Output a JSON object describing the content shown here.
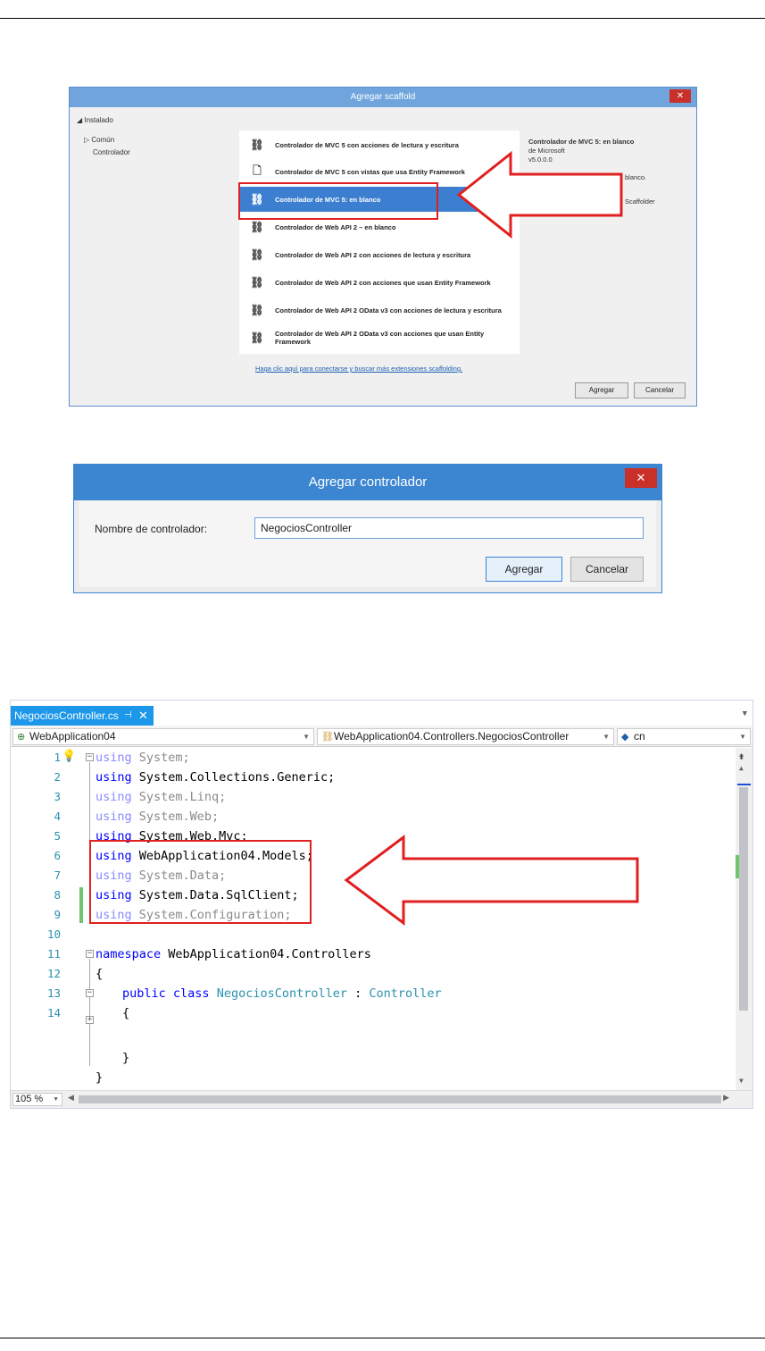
{
  "scaffold_dialog": {
    "title": "Agregar scaffold",
    "close": "✕",
    "tree": {
      "installed": "◢ Instalado",
      "common": "▷ Común",
      "controller": "Controlador"
    },
    "items": [
      {
        "label": "Controlador de MVC 5 con acciones de lectura y escritura",
        "icon": "controller-icon"
      },
      {
        "label": "Controlador de MVC 5 con vistas que usa Entity Framework",
        "icon": "page-icon"
      },
      {
        "label": "Controlador de MVC 5: en blanco",
        "icon": "controller-icon"
      },
      {
        "label": "Controlador de Web API 2 – en blanco",
        "icon": "controller-icon"
      },
      {
        "label": "Controlador de Web API 2 con acciones de lectura y escritura",
        "icon": "controller-icon"
      },
      {
        "label": "Controlador de Web API 2 con acciones que usan Entity Framework",
        "icon": "controller-icon"
      },
      {
        "label": "Controlador de Web API 2 OData v3 con acciones de lectura y escritura",
        "icon": "controller-icon"
      },
      {
        "label": "Controlador de Web API 2 OData v3 con acciones que usan Entity Framework",
        "icon": "controller-icon"
      }
    ],
    "selected_index": 2,
    "info": {
      "title": "Controlador de MVC 5: en blanco",
      "vendor": "de Microsoft",
      "version": "v5.0.0.0",
      "desc_tail": "blanco.",
      "scaffolder_tail": "Scaffolder"
    },
    "link": "Haga clic aquí para conectarse y buscar más extensiones scaffolding.",
    "add_button": "Agregar",
    "cancel_button": "Cancelar"
  },
  "controller_dialog": {
    "title": "Agregar controlador",
    "close": "✕",
    "label": "Nombre de controlador:",
    "name_value": "NegociosController",
    "add_button": "Agregar",
    "cancel_button": "Cancelar"
  },
  "editor": {
    "tab": {
      "title": "NegociosController.cs",
      "pin": "⊣",
      "close": "✕"
    },
    "nav": {
      "project": "WebApplication04",
      "type": "WebApplication04.Controllers.NegociosController",
      "member": "cn"
    },
    "line_numbers": [
      "1",
      "2",
      "3",
      "4",
      "5",
      "6",
      "7",
      "8",
      "9",
      "10",
      "11",
      "12",
      "13",
      "14"
    ],
    "code": {
      "l1_kw": "using",
      "l1_rest": " System;",
      "l2_kw": "using",
      "l2_rest": " System.Collections.Generic;",
      "l3_kw": "using",
      "l3_rest": " System.Linq;",
      "l4_kw": "using",
      "l4_rest": " System.Web;",
      "l5_kw": "using",
      "l5_rest": " System.Web.Mvc;",
      "l6_kw": "using",
      "l6_rest": " WebApplication04.Models;",
      "l7_kw": "using",
      "l7_rest": " System.Data;",
      "l8_kw": "using",
      "l8_rest": " System.Data.SqlClient;",
      "l9_kw": "using",
      "l9_rest": " System.Configuration;",
      "l11_kw": "namespace",
      "l11_rest": " WebApplication04.Controllers",
      "l12": "{",
      "l13_kw": "public class",
      "l13_type": "NegociosController",
      "l13_colon": " : ",
      "l13_base": "Controller",
      "l14": "{",
      "l15": "}",
      "l16": "}"
    },
    "zoom": "105 %"
  },
  "colors": {
    "highlight_red": "#e02020",
    "tab_blue": "#1c97ea",
    "selection_blue": "#3c7fd0",
    "keyword_blue": "#0000ff",
    "type_teal": "#2b91af",
    "change_green": "#6cc66c"
  }
}
